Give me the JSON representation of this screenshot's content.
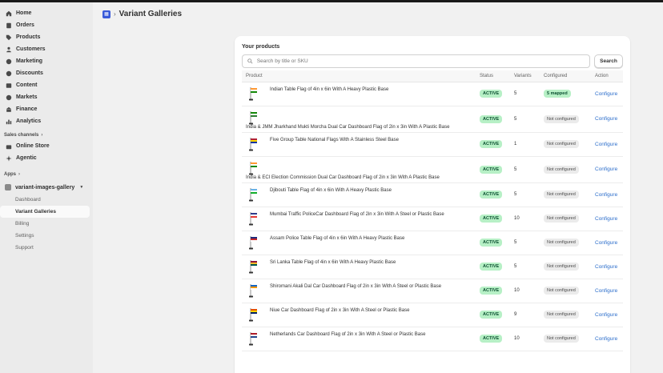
{
  "sidebar": {
    "nav": [
      {
        "label": "Home",
        "icon": "home-icon"
      },
      {
        "label": "Orders",
        "icon": "orders-icon"
      },
      {
        "label": "Products",
        "icon": "tag-icon"
      },
      {
        "label": "Customers",
        "icon": "person-icon"
      },
      {
        "label": "Marketing",
        "icon": "target-icon"
      },
      {
        "label": "Discounts",
        "icon": "discount-icon"
      },
      {
        "label": "Content",
        "icon": "content-icon"
      },
      {
        "label": "Markets",
        "icon": "globe-icon"
      },
      {
        "label": "Finance",
        "icon": "bank-icon"
      },
      {
        "label": "Analytics",
        "icon": "chart-icon"
      }
    ],
    "sales_channels_label": "Sales channels",
    "sales_channels": [
      {
        "label": "Online Store",
        "icon": "store-icon"
      },
      {
        "label": "Agentic",
        "icon": "sparkle-icon"
      }
    ],
    "apps_label": "Apps",
    "app_name": "variant-images-gallery",
    "app_items": [
      "Dashboard",
      "Variant Galleries",
      "Billing",
      "Settings",
      "Support"
    ]
  },
  "header": {
    "title": "Variant Galleries"
  },
  "card": {
    "title": "Your products",
    "search_placeholder": "Search by title or SKU",
    "search_button": "Search",
    "columns": [
      "Product",
      "Status",
      "Variants",
      "Configured",
      "Action"
    ],
    "rows": [
      {
        "name": "Indian Table Flag of 4in x 6in With A Heavy Plastic Base",
        "status": "ACTIVE",
        "variants": "5",
        "configured": "5 mapped",
        "action": "Configure",
        "layout": "inline"
      },
      {
        "name": "India & JMM Jharkhand Mukti Morcha Dual Car Dashboard Flag of 2in x 3in With A Plastic Base",
        "status": "ACTIVE",
        "variants": "5",
        "configured": "Not configured",
        "action": "Configure",
        "layout": "below"
      },
      {
        "name": "Five Group Table National Flags With A Stainless Steel Base",
        "status": "ACTIVE",
        "variants": "1",
        "configured": "Not configured",
        "action": "Configure",
        "layout": "inline"
      },
      {
        "name": "India & ECI Election Commission Dual Car Dashboard Flag of 2in x 3in With A Plastic Base",
        "status": "ACTIVE",
        "variants": "5",
        "configured": "Not configured",
        "action": "Configure",
        "layout": "below"
      },
      {
        "name": "Djibouti Table Flag of 4in x 6in With A Heavy Plastic Base",
        "status": "ACTIVE",
        "variants": "5",
        "configured": "Not configured",
        "action": "Configure",
        "layout": "inline"
      },
      {
        "name": "Mumbai Traffic PoliceCar Dashboard Flag of 2in x 3in With A Steel or Plastic Base",
        "status": "ACTIVE",
        "variants": "10",
        "configured": "Not configured",
        "action": "Configure",
        "layout": "inline"
      },
      {
        "name": "Assam Police Table Flag of 4in x 6in With A Heavy Plastic Base",
        "status": "ACTIVE",
        "variants": "5",
        "configured": "Not configured",
        "action": "Configure",
        "layout": "inline"
      },
      {
        "name": "Sri Lanka Table Flag of 4in x 6in With A Heavy Plastic Base",
        "status": "ACTIVE",
        "variants": "5",
        "configured": "Not configured",
        "action": "Configure",
        "layout": "inline"
      },
      {
        "name": "Shiromani Akali Dal Car Dashboard Flag of 2in x 3in With A Steel or Plastic Base",
        "status": "ACTIVE",
        "variants": "10",
        "configured": "Not configured",
        "action": "Configure",
        "layout": "inline"
      },
      {
        "name": "Niue Car Dashboard Flag of 2in x 3in With A Steel or Plastic Base",
        "status": "ACTIVE",
        "variants": "9",
        "configured": "Not configured",
        "action": "Configure",
        "layout": "inline"
      },
      {
        "name": "Netherlands Car Dashboard Flag of 2in x 3in With A Steel or Plastic Base",
        "status": "ACTIVE",
        "variants": "10",
        "configured": "Not configured",
        "action": "Configure",
        "layout": "inline"
      }
    ]
  },
  "colors": {
    "link": "#2c6ecb",
    "active_badge": "#b7f0c6",
    "sidebar_bg": "#ebebeb",
    "page_bg": "#f1f1f1"
  }
}
